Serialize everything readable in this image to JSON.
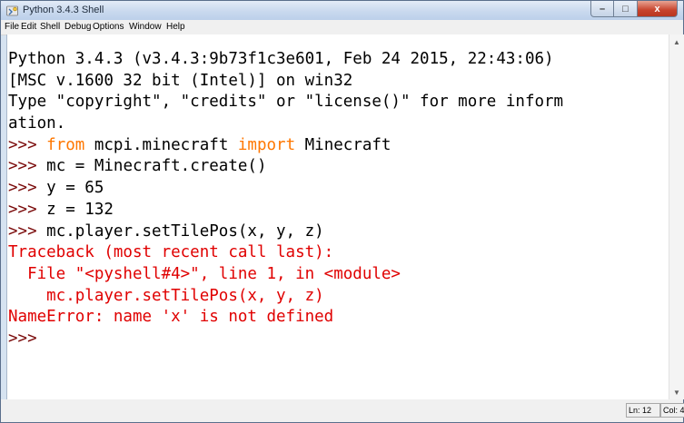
{
  "window": {
    "title": "Python 3.4.3 Shell",
    "buttons": {
      "minimize": "–",
      "maximize": "□",
      "close": "x"
    }
  },
  "menubar": {
    "items": [
      "File",
      "Edit",
      "Shell",
      "Debug",
      "Options",
      "Window",
      "Help"
    ]
  },
  "shell": {
    "lines": [
      {
        "segments": [
          {
            "text": "Python 3.4.3 (v3.4.3:9b73f1c3e601, Feb 24 2015, 22:43:06)",
            "style": "normal"
          }
        ]
      },
      {
        "segments": [
          {
            "text": "[MSC v.1600 32 bit (Intel)] on win32",
            "style": "normal"
          }
        ]
      },
      {
        "segments": [
          {
            "text": "Type \"copyright\", \"credits\" or \"license()\" for more inform",
            "style": "normal"
          }
        ]
      },
      {
        "segments": [
          {
            "text": "ation.",
            "style": "normal"
          }
        ]
      },
      {
        "segments": [
          {
            "text": ">>> ",
            "style": "prompt"
          },
          {
            "text": "from",
            "style": "keyword"
          },
          {
            "text": " mcpi.minecraft ",
            "style": "normal"
          },
          {
            "text": "import",
            "style": "keyword"
          },
          {
            "text": " Minecraft",
            "style": "normal"
          }
        ]
      },
      {
        "segments": [
          {
            "text": ">>> ",
            "style": "prompt"
          },
          {
            "text": "mc = Minecraft.create()",
            "style": "normal"
          }
        ]
      },
      {
        "segments": [
          {
            "text": ">>> ",
            "style": "prompt"
          },
          {
            "text": "y = 65",
            "style": "normal"
          }
        ]
      },
      {
        "segments": [
          {
            "text": ">>> ",
            "style": "prompt"
          },
          {
            "text": "z = 132",
            "style": "normal"
          }
        ]
      },
      {
        "segments": [
          {
            "text": ">>> ",
            "style": "prompt"
          },
          {
            "text": "mc.player.setTilePos(x, y, z)",
            "style": "normal"
          }
        ]
      },
      {
        "segments": [
          {
            "text": "Traceback (most recent call last):",
            "style": "error"
          }
        ]
      },
      {
        "segments": [
          {
            "text": "  File \"<pyshell#4>\", line 1, in <module>",
            "style": "error"
          }
        ]
      },
      {
        "segments": [
          {
            "text": "    mc.player.setTilePos(x, y, z)",
            "style": "error"
          }
        ]
      },
      {
        "segments": [
          {
            "text": "NameError: name 'x' is not defined",
            "style": "error"
          }
        ]
      },
      {
        "segments": [
          {
            "text": ">>> ",
            "style": "prompt"
          }
        ]
      }
    ]
  },
  "statusbar": {
    "line": "Ln: 12",
    "col": "Col: 4"
  },
  "colors": {
    "keyword": "#ff7700",
    "prompt": "#7a0a0a",
    "error": "#e00000",
    "text": "#000000"
  },
  "icons": {
    "app": "python-idle-icon",
    "scroll_up": "scroll-up-arrow-icon",
    "scroll_down": "scroll-down-arrow-icon"
  }
}
